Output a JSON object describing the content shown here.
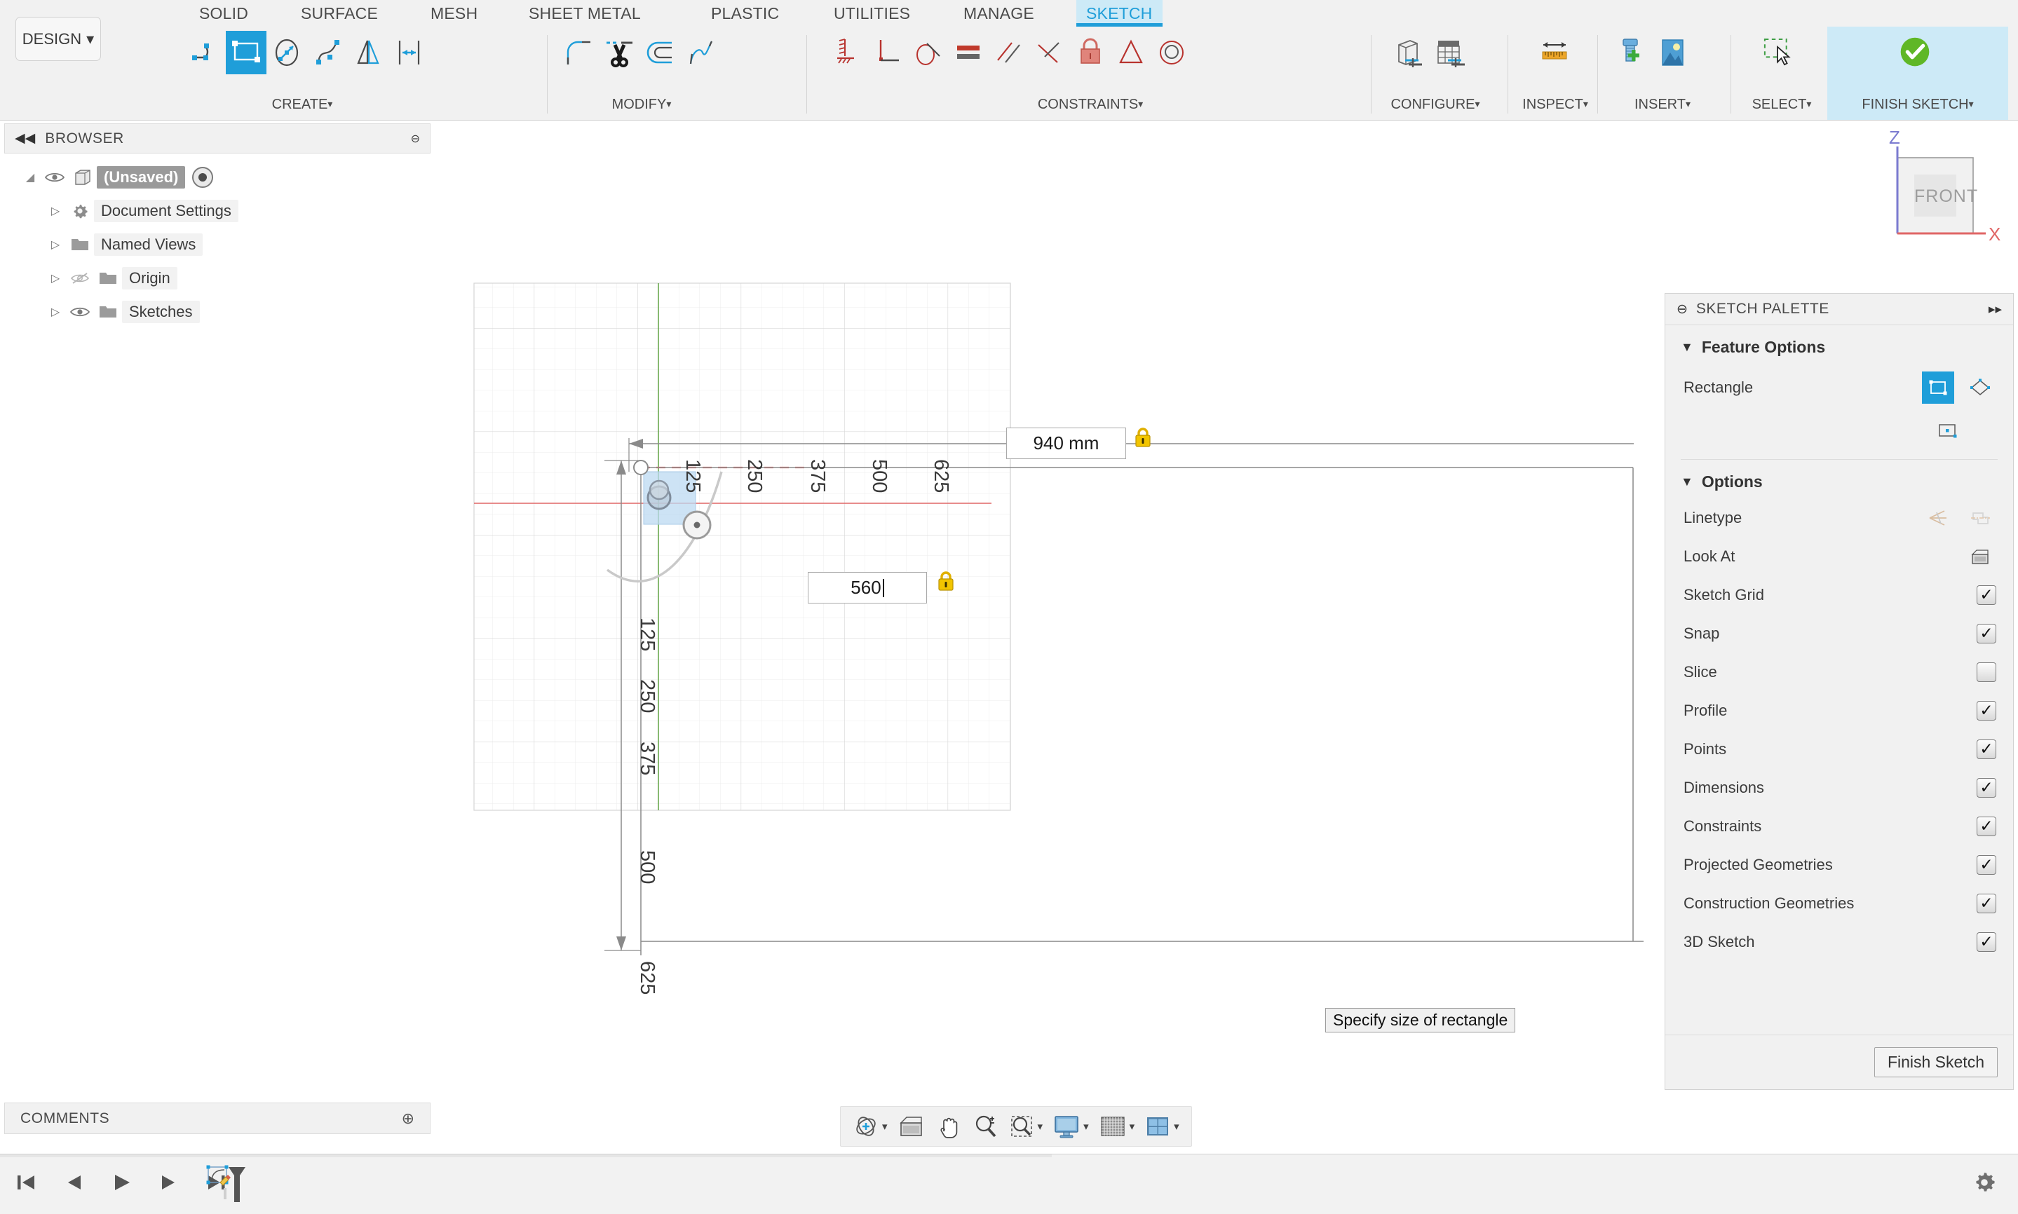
{
  "app": {
    "workspace": "DESIGN",
    "workspace_caret": "▾"
  },
  "ribbon": {
    "tabs": [
      {
        "label": "SOLID",
        "active": false
      },
      {
        "label": "SURFACE",
        "active": false
      },
      {
        "label": "MESH",
        "active": false
      },
      {
        "label": "SHEET METAL",
        "active": false
      },
      {
        "label": "PLASTIC",
        "active": false
      },
      {
        "label": "UTILITIES",
        "active": false
      },
      {
        "label": "MANAGE",
        "active": false
      },
      {
        "label": "SKETCH",
        "active": true
      }
    ],
    "panels": [
      {
        "label": "CREATE",
        "caret": "▾"
      },
      {
        "label": "MODIFY",
        "caret": "▾"
      },
      {
        "label": "CONSTRAINTS",
        "caret": "▾"
      },
      {
        "label": "CONFIGURE",
        "caret": "▾"
      },
      {
        "label": "INSPECT",
        "caret": "▾"
      },
      {
        "label": "INSERT",
        "caret": "▾"
      },
      {
        "label": "SELECT",
        "caret": "▾"
      },
      {
        "label": "FINISH SKETCH",
        "caret": "▾"
      }
    ]
  },
  "browser": {
    "title": "BROWSER",
    "collapse_icon": "◀◀",
    "minimize_icon": "⊖",
    "items": [
      {
        "label": "(Unsaved)",
        "arrow": "◢",
        "has_eye": true,
        "eye_off": false,
        "icon": "body-icon",
        "root": true,
        "radio": true
      },
      {
        "label": "Document Settings",
        "arrow": "▷",
        "has_eye": false,
        "eye_off": false,
        "icon": "gear-icon",
        "root": false,
        "radio": false
      },
      {
        "label": "Named Views",
        "arrow": "▷",
        "has_eye": false,
        "eye_off": false,
        "icon": "folder-icon",
        "root": false,
        "radio": false
      },
      {
        "label": "Origin",
        "arrow": "▷",
        "has_eye": true,
        "eye_off": true,
        "icon": "folder-icon",
        "root": false,
        "radio": false
      },
      {
        "label": "Sketches",
        "arrow": "▷",
        "has_eye": true,
        "eye_off": false,
        "icon": "folder-icon",
        "root": false,
        "radio": false
      }
    ]
  },
  "comments": {
    "title": "COMMENTS",
    "add_icon": "⊕"
  },
  "canvas": {
    "tooltip": "Specify size of rectangle",
    "width_input": {
      "value": "940 mm",
      "locked": true
    },
    "height_input": {
      "value": "560",
      "locked": true
    },
    "ruler_labels_horizontal": [
      "125",
      "250",
      "375",
      "500",
      "625"
    ],
    "ruler_labels_vertical": [
      "125",
      "250",
      "375",
      "500",
      "625"
    ],
    "viewcube": {
      "face": "FRONT",
      "axis_z": "Z",
      "axis_x": "X"
    }
  },
  "navbar": {
    "items": [
      {
        "icon": "orbit-icon",
        "caret": "▾"
      },
      {
        "icon": "look-at-icon",
        "caret": ""
      },
      {
        "icon": "pan-icon",
        "caret": ""
      },
      {
        "icon": "zoom-icon",
        "caret": ""
      },
      {
        "icon": "zoom-window-icon",
        "caret": "▾"
      },
      {
        "icon": "display-settings-icon",
        "caret": "▾"
      },
      {
        "icon": "grid-snaps-icon",
        "caret": "▾"
      },
      {
        "icon": "viewports-icon",
        "caret": "▾"
      }
    ]
  },
  "palette": {
    "title": "SKETCH PALETTE",
    "minimize_icon": "⊖",
    "expand_icon": "▸▸",
    "sections": [
      {
        "title": "Feature Options",
        "triangle": "▼",
        "rows": [
          {
            "label": "Rectangle",
            "type": "swatches",
            "selected_index": 0,
            "swatches": [
              "rectangle-2point-icon",
              "rectangle-3point-icon",
              "rectangle-center-icon"
            ]
          }
        ]
      },
      {
        "title": "Options",
        "triangle": "▼",
        "rows": [
          {
            "label": "Linetype",
            "type": "swatches",
            "selected_index": -1,
            "swatches": [
              "construction-line-icon",
              "centerline-icon"
            ]
          },
          {
            "label": "Look At",
            "type": "button",
            "icon": "look-at-icon"
          },
          {
            "label": "Sketch Grid",
            "type": "checkbox",
            "checked": true
          },
          {
            "label": "Snap",
            "type": "checkbox",
            "checked": true
          },
          {
            "label": "Slice",
            "type": "checkbox",
            "checked": false
          },
          {
            "label": "Profile",
            "type": "checkbox",
            "checked": true
          },
          {
            "label": "Points",
            "type": "checkbox",
            "checked": true
          },
          {
            "label": "Dimensions",
            "type": "checkbox",
            "checked": true
          },
          {
            "label": "Constraints",
            "type": "checkbox",
            "checked": true
          },
          {
            "label": "Projected Geometries",
            "type": "checkbox",
            "checked": true
          },
          {
            "label": "Construction Geometries",
            "type": "checkbox",
            "checked": true
          },
          {
            "label": "3D Sketch",
            "type": "checkbox",
            "checked": true
          }
        ]
      }
    ],
    "footer_button": "Finish Sketch"
  },
  "timeline": {
    "controls": [
      "go-to-start-icon",
      "step-back-icon",
      "play-icon",
      "step-forward-icon",
      "go-to-end-icon"
    ],
    "feature": "sketch-feature-icon",
    "settings": "gear-icon"
  },
  "colors": {
    "accent": "#1f9ed9",
    "accent_pale": "#cdeaf7",
    "panel_bg": "#f1f1f1",
    "border": "#d2d2d2",
    "text": "#3c3c3c",
    "x_axis": "#e06666",
    "y_axis": "#6aa84f",
    "lock_yellow": "#e8b410",
    "profile_fill": "#bed9f0",
    "green_check": "#5fb726"
  }
}
